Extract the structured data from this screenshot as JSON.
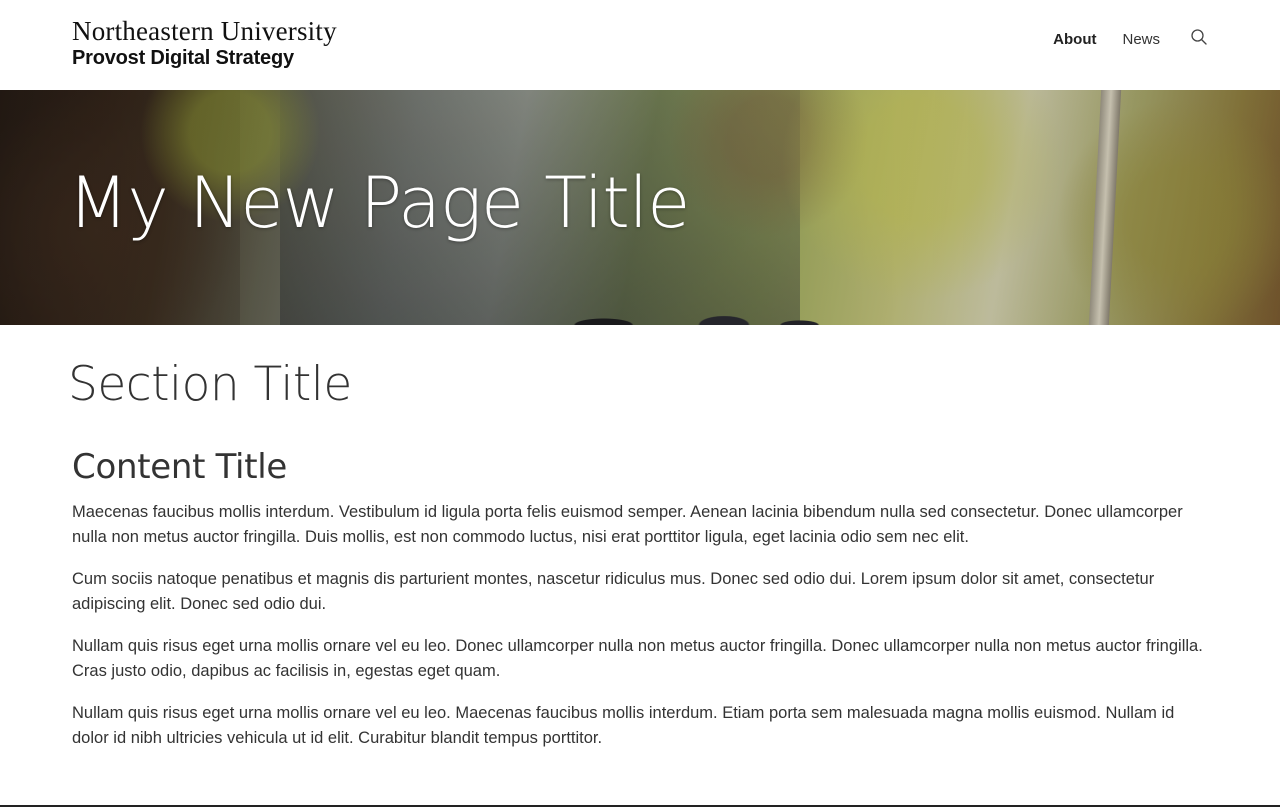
{
  "header": {
    "logo_line1": "Northeastern University",
    "logo_line2": "Provost Digital Strategy",
    "nav": [
      {
        "label": "About",
        "active": true
      },
      {
        "label": "News",
        "active": false
      }
    ],
    "search_icon": "search-icon"
  },
  "hero": {
    "title": "My New Page Title"
  },
  "main": {
    "section_title": "Section Title",
    "content_title": "Content Title",
    "paragraphs": [
      "Maecenas faucibus mollis interdum. Vestibulum id ligula porta felis euismod semper. Aenean lacinia bibendum nulla sed consectetur. Donec ullamcorper nulla non metus auctor fringilla. Duis mollis, est non commodo luctus, nisi erat porttitor ligula, eget lacinia odio sem nec elit.",
      "Cum sociis natoque penatibus et magnis dis parturient montes, nascetur ridiculus mus. Donec sed odio dui. Lorem ipsum dolor sit amet, consectetur adipiscing elit. Donec sed odio dui.",
      "Nullam quis risus eget urna mollis ornare vel eu leo. Donec ullamcorper nulla non metus auctor fringilla. Donec ullamcorper nulla non metus auctor fringilla. Cras justo odio, dapibus ac facilisis in, egestas eget quam.",
      "Nullam quis risus eget urna mollis ornare vel eu leo. Maecenas faucibus mollis interdum. Etiam porta sem malesuada magna mollis euismod. Nullam id dolor id nibh ultricies vehicula ut id elit. Curabitur blandit tempus porttitor."
    ]
  },
  "colors": {
    "text": "#333333",
    "background": "#ffffff",
    "hero_title": "#ffffff"
  }
}
